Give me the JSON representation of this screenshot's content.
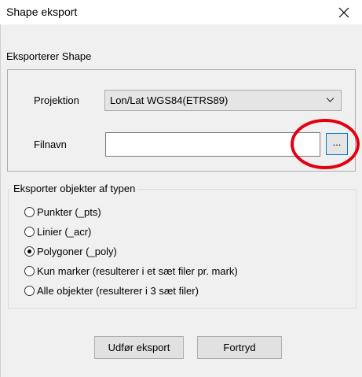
{
  "window": {
    "title": "Shape eksport"
  },
  "header": {
    "heading": "Eksporterer Shape"
  },
  "projection": {
    "label": "Projektion",
    "selected": "Lon/Lat WGS84(ETRS89)"
  },
  "filename": {
    "label": "Filnavn",
    "value": "",
    "browse_label": "..."
  },
  "export_types": {
    "legend": "Eksporter objekter af typen",
    "options": [
      {
        "label": "Punkter (_pts)",
        "checked": false
      },
      {
        "label": "Linier (_acr)",
        "checked": false
      },
      {
        "label": "Polygoner (_poly)",
        "checked": true
      },
      {
        "label": "Kun marker (resulterer i et sæt filer pr. mark)",
        "checked": false
      },
      {
        "label": "Alle objekter (resulterer i 3 sæt filer)",
        "checked": false
      }
    ]
  },
  "buttons": {
    "export_label": "Udfør eksport",
    "cancel_label": "Fortryd"
  },
  "colors": {
    "highlight_circle": "#e3000f",
    "focus_border": "#0078d7"
  }
}
